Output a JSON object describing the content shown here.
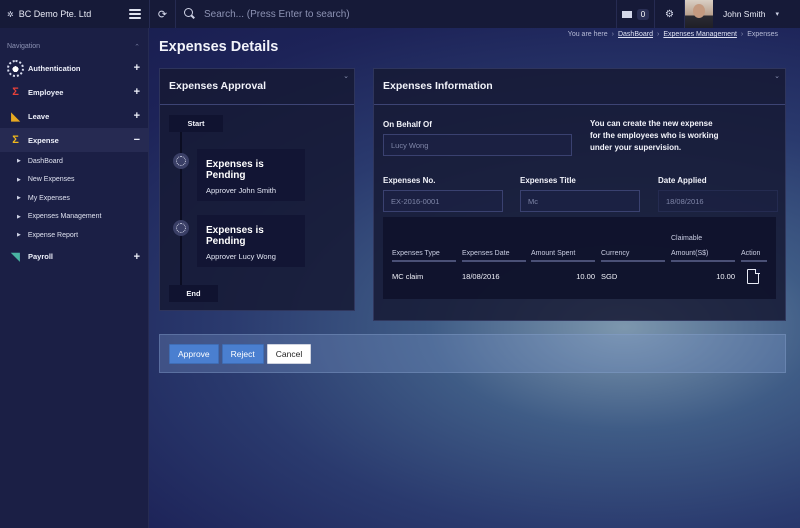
{
  "topbar": {
    "brand": "BC Demo Pte. Ltd",
    "brand_icon": "cog-logo-icon",
    "search_placeholder": "Search... (Press Enter to search)",
    "mail_count": "0",
    "user_name": "John Smith"
  },
  "sidebar": {
    "heading": "Navigation",
    "items": [
      {
        "label": "Authentication",
        "icon": "auth-icon",
        "toggle": "+"
      },
      {
        "label": "Employee",
        "icon": "employee-icon",
        "toggle": "+"
      },
      {
        "label": "Leave",
        "icon": "leave-icon",
        "toggle": "+"
      },
      {
        "label": "Expense",
        "icon": "expense-icon",
        "toggle": "−"
      },
      {
        "label": "Payroll",
        "icon": "payroll-icon",
        "toggle": "+"
      }
    ],
    "expense_sub": [
      "DashBoard",
      "New Expenses",
      "My Expenses",
      "Expenses Management",
      "Expense Report"
    ]
  },
  "page": {
    "title": "Expenses Details",
    "breadcrumb": {
      "prefix": "You are here",
      "items": [
        "DashBoard",
        "Expenses Management",
        "Expenses"
      ]
    }
  },
  "approval": {
    "title": "Expenses Approval",
    "start": "Start",
    "end": "End",
    "steps": [
      {
        "title": "Expenses is Pending",
        "subtitle": "Approver John Smith"
      },
      {
        "title": "Expenses is Pending",
        "subtitle": "Approver Lucy Wong"
      }
    ]
  },
  "info": {
    "title": "Expenses Information",
    "behalf_label": "On Behalf Of",
    "behalf_value": "Lucy Wong",
    "note": "You can create the new expense for the employees who is working under your supervision.",
    "no_label": "Expenses No.",
    "no_value": "EX-2016-0001",
    "title_label": "Expenses Title",
    "title_value": "Mc",
    "date_label": "Date Applied",
    "date_value": "18/08/2016",
    "table": {
      "headers": [
        "Expenses Type",
        "Expenses Date",
        "Amount Spent",
        "Currency",
        "Claimable",
        "Amount(S$)",
        "Action"
      ],
      "rows": [
        {
          "type": "MC claim",
          "date": "18/08/2016",
          "amount": "10.00",
          "currency": "SGD",
          "claimable": "10.00"
        }
      ]
    }
  },
  "actions": {
    "approve": "Approve",
    "reject": "Reject",
    "cancel": "Cancel"
  }
}
